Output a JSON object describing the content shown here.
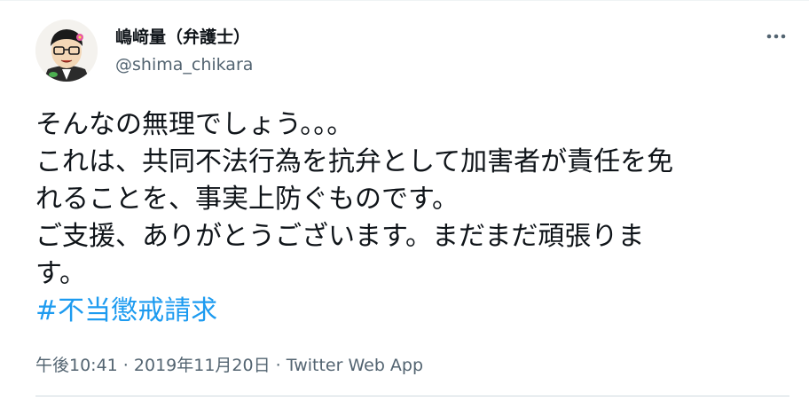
{
  "author": {
    "display_name": "嶋﨑量（弁護士）",
    "handle": "@shima_chikara"
  },
  "tweet": {
    "lines": [
      "そんなの無理でしょう。。。",
      "これは、共同不法行為を抗弁として加害者が責任を免",
      "れることを、事実上防ぐものです。",
      "ご支援、ありがとうございます。まだまだ頑張りま",
      "す。"
    ],
    "hashtag": "#不当懲戒請求"
  },
  "meta": {
    "time": "午後10:41",
    "separator1": " · ",
    "date": "2019年11月20日",
    "separator2": " · ",
    "source": "Twitter Web App"
  },
  "icons": {
    "avatar": "lawyer-cartoon-avatar",
    "more": "more-horizontal-icon"
  },
  "colors": {
    "hashtag": "#1d9bf0",
    "secondary_text": "#536471",
    "primary_text": "#0f1419"
  }
}
